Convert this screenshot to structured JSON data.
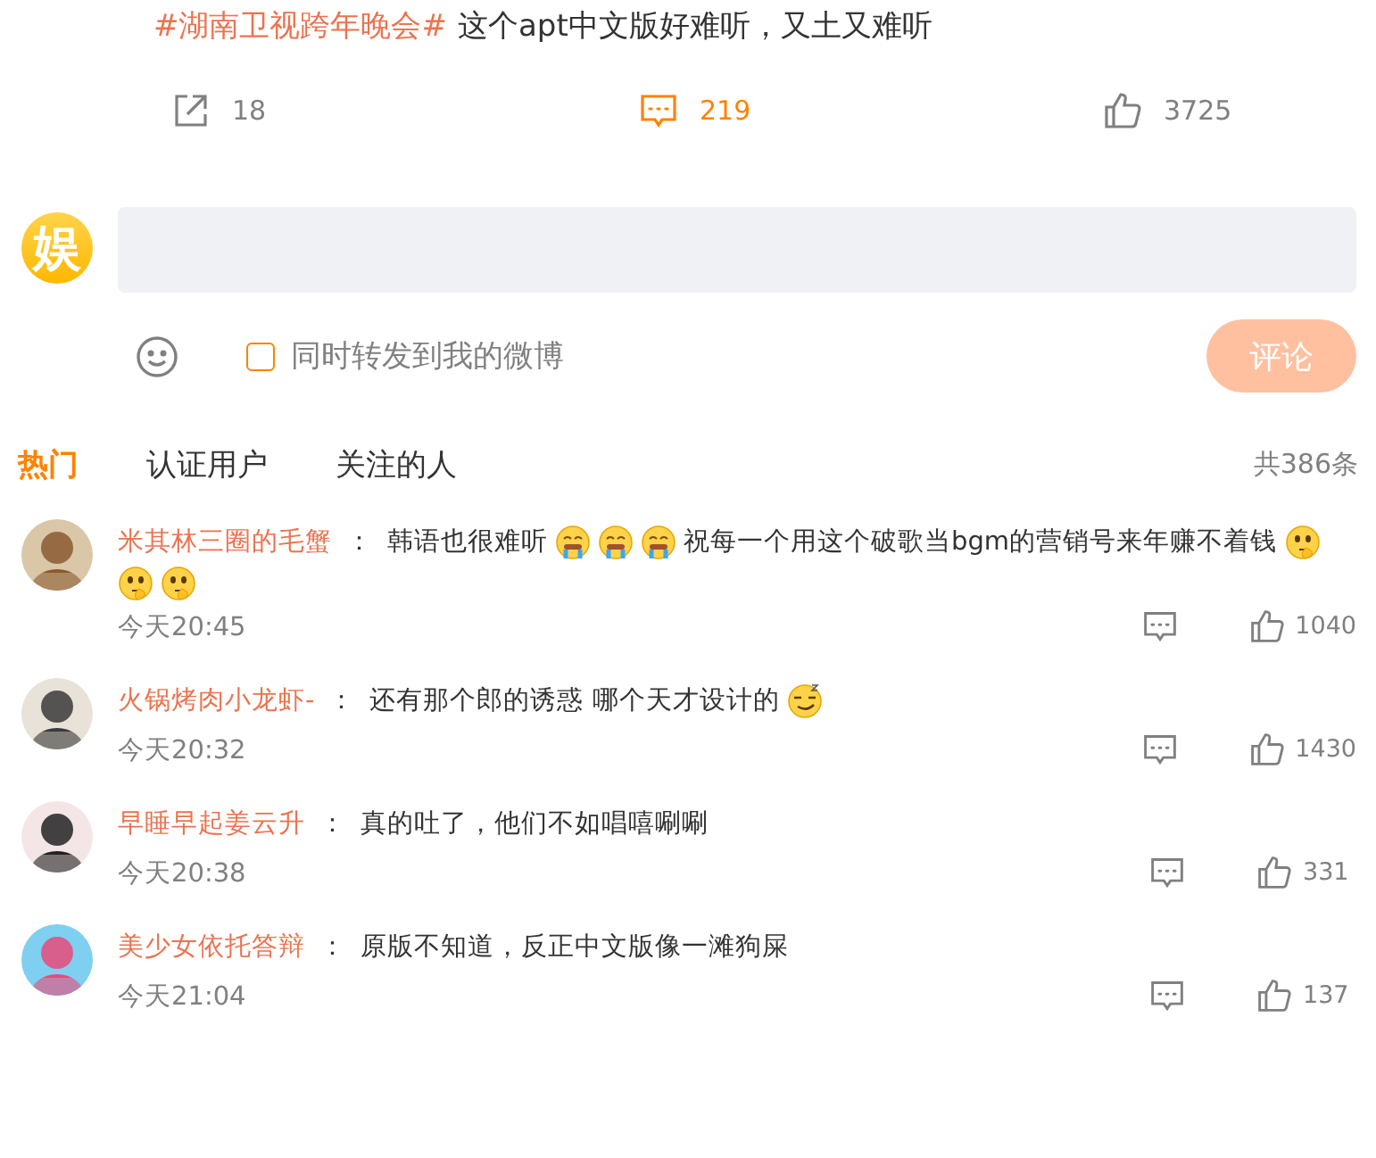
{
  "post": {
    "hashtag": "#湖南卫视跨年晚会#",
    "text": "这个apt中文版好难听，又土又难听",
    "actions": [
      {
        "kind": "share",
        "count": "18",
        "selected": false
      },
      {
        "kind": "comment",
        "count": "219",
        "selected": true
      },
      {
        "kind": "like",
        "count": "3725",
        "selected": false
      }
    ]
  },
  "composer": {
    "avatar_text": "娱",
    "repost": {
      "label": "同时转发到我的微博",
      "checked": false
    },
    "submit": "评论"
  },
  "tabs": [
    {
      "label": "热门",
      "selected": true
    },
    {
      "label": "认证用户",
      "selected": false
    },
    {
      "label": "关注的人",
      "selected": false
    }
  ],
  "total": "共386条",
  "comments": [
    {
      "user": "米其林三圈的毛蟹",
      "colon": "：",
      "parts": [
        {
          "kind": "text",
          "text": "韩语也很难听"
        },
        {
          "kind": "sob"
        },
        {
          "kind": "sob"
        },
        {
          "kind": "sob"
        },
        {
          "kind": "text",
          "text": "祝每一个用这个破歌当bgm的营销号来年赚不着钱"
        },
        {
          "kind": "ponder"
        },
        {
          "kind": "ponder"
        },
        {
          "kind": "ponder"
        }
      ],
      "time": "今天20:45",
      "likes": "1040"
    },
    {
      "user": "火锅烤肉小龙虾-",
      "colon": "：",
      "parts": [
        {
          "kind": "text",
          "text": "还有那个郎的诱惑 哪个天才设计的"
        },
        {
          "kind": "sleepy"
        }
      ],
      "time": "今天20:32",
      "likes": "1430"
    },
    {
      "user": "早睡早起姜云升",
      "colon": "：",
      "parts": [
        {
          "kind": "text",
          "text": "真的吐了，他们不如唱嘻唰唰"
        }
      ],
      "time": "今天20:38",
      "likes": "331"
    },
    {
      "user": "美少女依托答辩",
      "colon": "：",
      "parts": [
        {
          "kind": "text",
          "text": "原版不知道，反正中文版像一滩狗屎"
        }
      ],
      "time": "今天21:04",
      "likes": "137"
    }
  ]
}
